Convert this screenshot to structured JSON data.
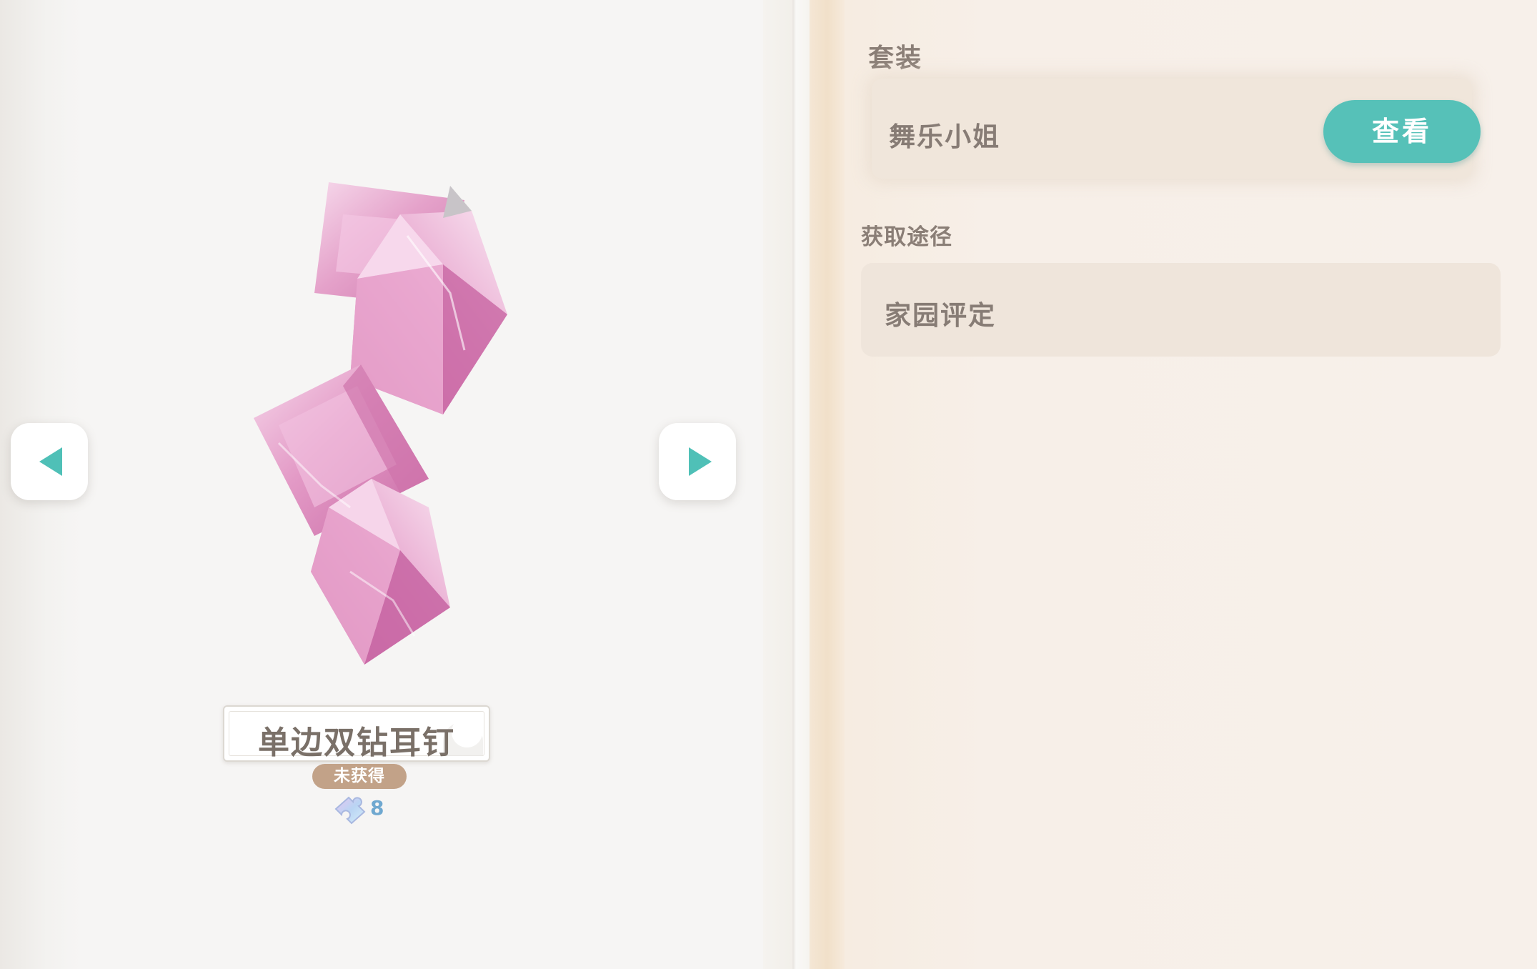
{
  "item": {
    "name": "单边双钻耳钉",
    "status": "未获得",
    "cost": "8",
    "image_icon": "pink-diamond-earring-icon",
    "cost_icon": "puzzle-piece-icon"
  },
  "navigation": {
    "prev_icon": "arrow-left-icon",
    "next_icon": "arrow-right-icon"
  },
  "suit_section": {
    "title": "套装",
    "suit_name": "舞乐小姐",
    "view_label": "查看"
  },
  "source_section": {
    "title": "获取途径",
    "source": "家园评定"
  },
  "colors": {
    "accent": "#56c1b8",
    "badge": "#c2a288",
    "text": "#877c75",
    "cost_number": "#6fa8d0"
  }
}
